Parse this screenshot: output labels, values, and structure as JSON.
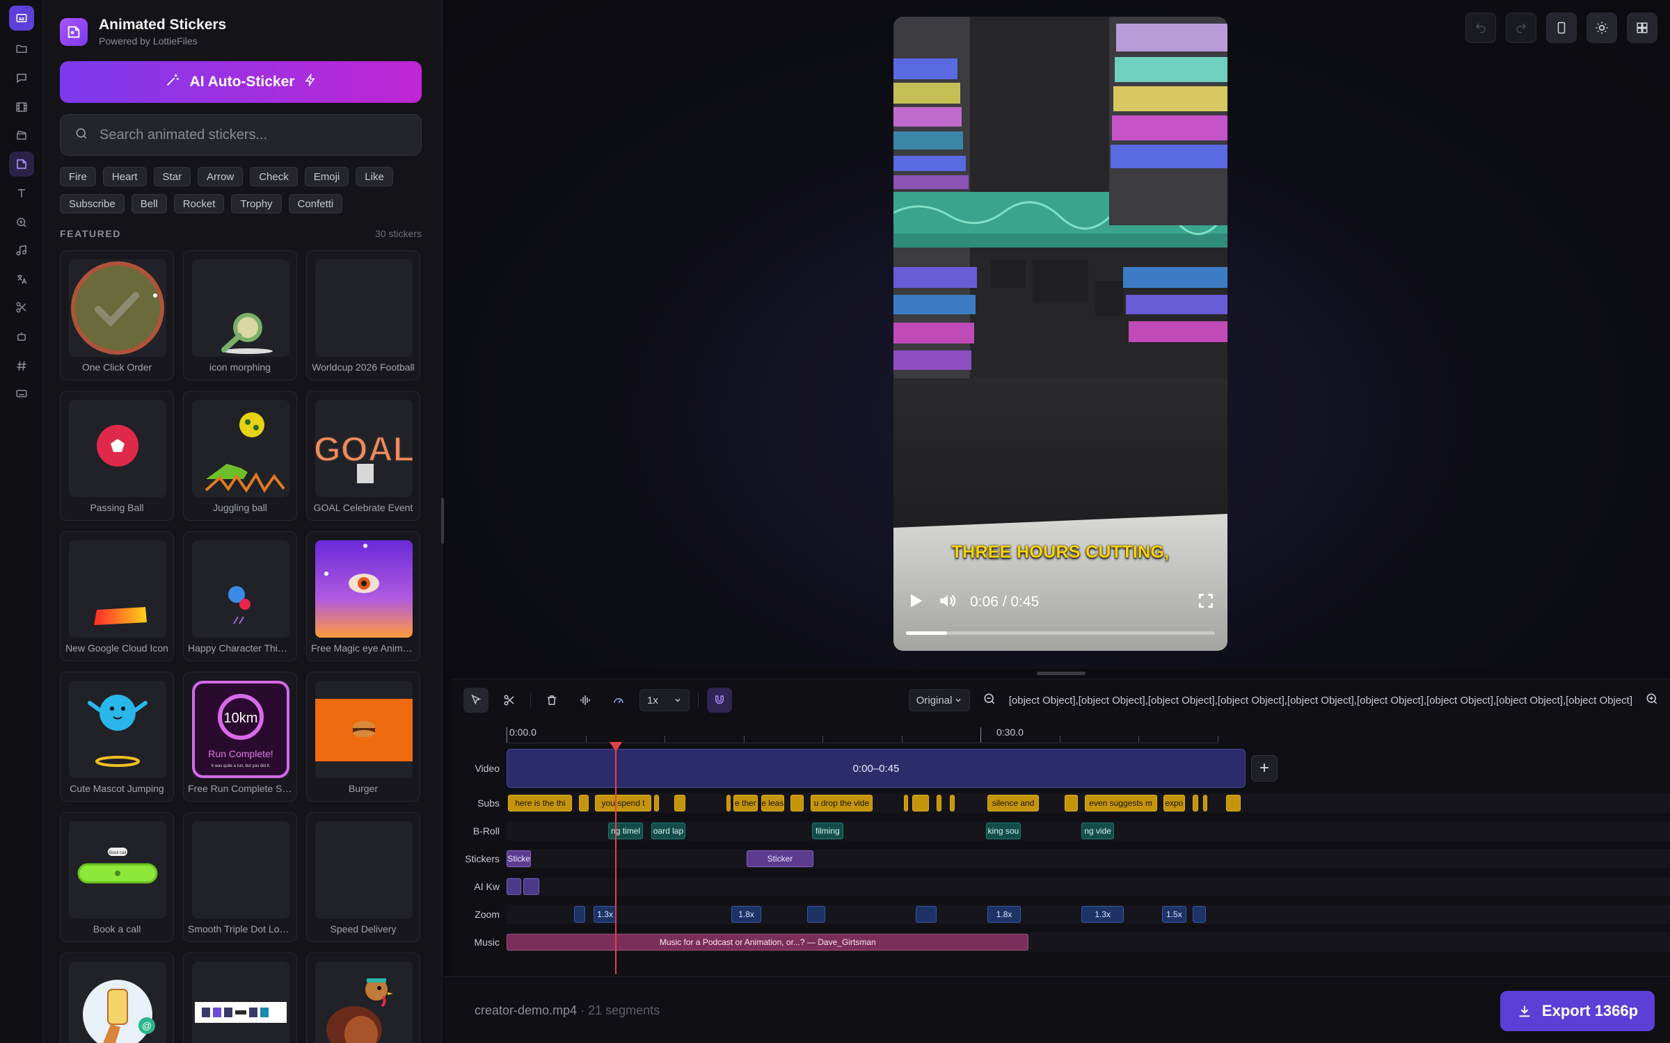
{
  "app": {
    "rail_icons": [
      "subtitles-icon",
      "folder-icon",
      "chat-icon",
      "film-icon",
      "clapper-icon",
      "sticker-icon",
      "text-icon",
      "zoom-icon",
      "music-icon",
      "translate-icon",
      "scissors-icon",
      "robot-icon",
      "hashtag-icon",
      "keyboard-icon"
    ]
  },
  "panel": {
    "title": "Animated Stickers",
    "subtitle": "Powered by LottieFiles",
    "ai_button": "AI Auto-Sticker",
    "search_placeholder": "Search animated stickers...",
    "chips_row1": [
      "Fire",
      "Heart",
      "Star",
      "Arrow",
      "Check",
      "Emoji",
      "Like"
    ],
    "chips_row2": [
      "Subscribe",
      "Bell",
      "Rocket",
      "Trophy",
      "Confetti"
    ],
    "featured_label": "FEATURED",
    "featured_count": "30 stickers",
    "stickers": [
      {
        "name": "One Click Order"
      },
      {
        "name": "icon morphing"
      },
      {
        "name": "Worldcup 2026 Football"
      },
      {
        "name": "Passing Ball"
      },
      {
        "name": "Juggling ball"
      },
      {
        "name": "GOAL Celebrate Event"
      },
      {
        "name": "New Google Cloud Icon"
      },
      {
        "name": "Happy Character Thinking"
      },
      {
        "name": "Free Magic eye Animation"
      },
      {
        "name": "Cute Mascot Jumping"
      },
      {
        "name": "Free Run Complete Screen"
      },
      {
        "name": "Burger"
      },
      {
        "name": "Book a call"
      },
      {
        "name": "Smooth Triple Dot Loader"
      },
      {
        "name": "Speed Delivery"
      },
      {
        "name": ""
      },
      {
        "name": ""
      },
      {
        "name": ""
      }
    ],
    "thumb_text": {
      "goal": "GOAL",
      "run_km": "10km",
      "run_title": "Run Complete!",
      "run_sub": "It was quite a run, but you did it.",
      "book_pill": "Book call"
    }
  },
  "topbar": {
    "buttons": [
      "undo-icon",
      "redo-icon",
      "phone-frame-icon",
      "sun-icon",
      "layout-grid-icon"
    ]
  },
  "video": {
    "caption": "THREE HOURS CUTTING,",
    "time": "0:06 / 0:45",
    "progress": 0.133
  },
  "timeline": {
    "speed": "1x",
    "fit": "Original",
    "zoom": [
      {
        "t": "",
        "s": 4.1,
        "e": 4.8
      },
      {
        "t": "1.3x",
        "s": 5.3,
        "e": 6.7
      },
      {
        "t": "1.8x",
        "s": 13.7,
        "e": 15.5
      },
      {
        "t": "",
        "s": 18.3,
        "e": 19.4
      },
      {
        "t": "",
        "s": 24.9,
        "e": 26.2
      },
      {
        "t": "1.8x",
        "s": 29.3,
        "e": 31.3
      },
      {
        "t": "1.3x",
        "s": 35.0,
        "e": 37.6
      },
      {
        "t": "1.5x",
        "s": 39.9,
        "e": 41.4
      },
      {
        "t": "",
        "s": 41.8,
        "e": 42.6
      }
    ],
    "ruler_labels": [
      "0:00.0",
      "0:30.0"
    ],
    "tracks": {
      "video": "Video",
      "subs": "Subs",
      "broll": "B-Roll",
      "stickers": "Stickers",
      "ai": "AI Kw",
      "zoom": "Zoom",
      "music": "Music"
    },
    "video_clip": "0:00–0:45",
    "subs": [
      {
        "t": "here is the thi",
        "s": 0.1,
        "e": 4.0
      },
      {
        "t": "",
        "s": 4.4,
        "e": 5.0
      },
      {
        "t": "you spend t",
        "s": 5.4,
        "e": 8.8
      },
      {
        "t": "",
        "s": 9.0,
        "e": 9.3
      },
      {
        "t": "",
        "s": 10.2,
        "e": 10.9
      },
      {
        "t": "",
        "s": 13.4,
        "e": 13.6
      },
      {
        "t": "e ther",
        "s": 13.8,
        "e": 15.3
      },
      {
        "t": "e leas",
        "s": 15.5,
        "e": 16.9
      },
      {
        "t": "",
        "s": 17.3,
        "e": 18.1
      },
      {
        "t": "u drop the vide",
        "s": 18.5,
        "e": 22.3
      },
      {
        "t": "",
        "s": 24.2,
        "e": 24.4
      },
      {
        "t": "",
        "s": 24.7,
        "e": 25.7
      },
      {
        "t": "",
        "s": 26.2,
        "e": 26.5
      },
      {
        "t": "",
        "s": 27.0,
        "e": 27.3
      },
      {
        "t": "silence and",
        "s": 29.3,
        "e": 32.4
      },
      {
        "t": "",
        "s": 34.0,
        "e": 34.8
      },
      {
        "t": "even suggests m",
        "s": 35.2,
        "e": 39.6
      },
      {
        "t": "expo",
        "s": 40.0,
        "e": 41.3
      },
      {
        "t": "",
        "s": 41.8,
        "e": 42.1
      },
      {
        "t": "",
        "s": 42.4,
        "e": 42.6
      },
      {
        "t": "",
        "s": 43.8,
        "e": 44.7
      }
    ],
    "broll": [
      {
        "t": "ng timel",
        "s": 6.2,
        "e": 8.3
      },
      {
        "t": "oard lap",
        "s": 8.8,
        "e": 10.9
      },
      {
        "t": "filming",
        "s": 18.6,
        "e": 20.5
      },
      {
        "t": "king sou",
        "s": 29.2,
        "e": 31.3
      },
      {
        "t": "ng vide",
        "s": 35.0,
        "e": 37.0
      }
    ],
    "stickers": [
      {
        "t": "Sticke",
        "s": 0.0,
        "e": 1.5
      },
      {
        "t": "Sticker",
        "s": 14.6,
        "e": 18.7
      }
    ],
    "ai": [
      {
        "t": "",
        "s": 0.0,
        "e": 0.9
      },
      {
        "t": "",
        "s": 1.0,
        "e": 2.0
      }
    ],
    "music": [
      {
        "t": "Music for a Podcast or Animation, or...? — Dave_Girtsman",
        "s": 0.0,
        "e": 31.8
      }
    ]
  },
  "footer": {
    "file": "creator-demo.mp4",
    "segments": "· 21 segments",
    "export": "Export 1366p"
  }
}
